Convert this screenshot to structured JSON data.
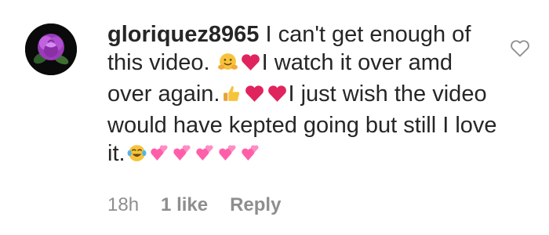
{
  "comment": {
    "username": "gloriquez8965",
    "text_1": " I can't get enough of this video. ",
    "text_2": "I watch it over amd over again.",
    "text_3": "I just wish the video would have kepted going but still I love it.",
    "emojis": [
      "hugging-face",
      "red-heart",
      "thumbs-up",
      "red-heart",
      "red-heart",
      "tears-of-joy",
      "heart-with-ribbon",
      "heart-with-ribbon",
      "heart-with-ribbon",
      "heart-with-ribbon",
      "heart-with-ribbon"
    ],
    "time_ago": "18h",
    "likes": "1 like",
    "reply_label": "Reply"
  },
  "colors": {
    "text": "#262626",
    "meta": "#8e8e8e",
    "heart": "#e0245e",
    "pink_heart": "#ff5fa8",
    "avatar_rose": "#b14fd1"
  }
}
